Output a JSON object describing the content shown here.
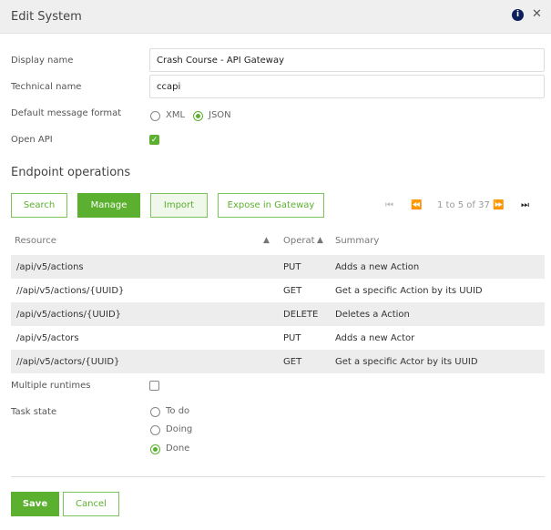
{
  "header": {
    "title": "Edit System",
    "info_icon": "info-icon",
    "close_icon": "close-icon"
  },
  "form": {
    "display_name": {
      "label": "Display name",
      "value": "Crash Course - API Gateway"
    },
    "technical_name": {
      "label": "Technical name",
      "value": "ccapi"
    },
    "message_format": {
      "label": "Default message format",
      "options": [
        "XML",
        "JSON"
      ],
      "selected": "JSON"
    },
    "open_api": {
      "label": "Open API",
      "checked": true
    },
    "multiple_runtimes": {
      "label": "Multiple runtimes",
      "checked": false
    },
    "task_state": {
      "label": "Task state",
      "options": [
        "To do",
        "Doing",
        "Done"
      ],
      "selected": "Done"
    }
  },
  "endpoints": {
    "title": "Endpoint operations",
    "buttons": {
      "search": "Search",
      "manage": "Manage",
      "import": "Import",
      "expose": "Expose in Gateway"
    },
    "pager": {
      "text": "1 to 5 of 37"
    },
    "columns": [
      "Resource",
      "Operat",
      "Summary"
    ],
    "rows": [
      {
        "resource": "/api/v5/actions",
        "operation": "PUT",
        "summary": "Adds a new Action"
      },
      {
        "resource": "//api/v5/actions/{UUID}",
        "operation": "GET",
        "summary": "Get a specific Action by its UUID"
      },
      {
        "resource": "/api/v5/actions/{UUID}",
        "operation": "DELETE",
        "summary": "Deletes a Action"
      },
      {
        "resource": "/api/v5/actors",
        "operation": "PUT",
        "summary": "Adds a new Actor"
      },
      {
        "resource": "//api/v5/actors/{UUID}",
        "operation": "GET",
        "summary": "Get a specific Actor by its UUID"
      }
    ]
  },
  "footer": {
    "save": "Save",
    "cancel": "Cancel"
  },
  "colors": {
    "accent": "#5cb030",
    "header_bg": "#efefef",
    "row_alt": "#ededed"
  }
}
